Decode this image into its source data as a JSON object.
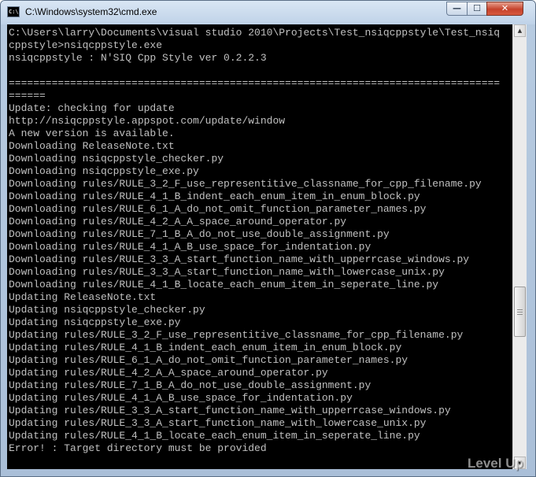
{
  "window": {
    "title": "C:\\Windows\\system32\\cmd.exe",
    "icon": "C:\\",
    "controls": {
      "minimize": "—",
      "maximize": "☐",
      "close": "✕"
    }
  },
  "console": {
    "lines": [
      "C:\\Users\\larry\\Documents\\visual studio 2010\\Projects\\Test_nsiqcppstyle\\Test_nsiq",
      "cppstyle>nsiqcppstyle.exe",
      "nsiqcppstyle : N'SIQ Cpp Style ver 0.2.2.3",
      "",
      "================================================================================",
      "======",
      "Update: checking for update",
      "http://nsiqcppstyle.appspot.com/update/window",
      "A new version is available.",
      "Downloading ReleaseNote.txt",
      "Downloading nsiqcppstyle_checker.py",
      "Downloading nsiqcppstyle_exe.py",
      "Downloading rules/RULE_3_2_F_use_representitive_classname_for_cpp_filename.py",
      "Downloading rules/RULE_4_1_B_indent_each_enum_item_in_enum_block.py",
      "Downloading rules/RULE_6_1_A_do_not_omit_function_parameter_names.py",
      "Downloading rules/RULE_4_2_A_A_space_around_operator.py",
      "Downloading rules/RULE_7_1_B_A_do_not_use_double_assignment.py",
      "Downloading rules/RULE_4_1_A_B_use_space_for_indentation.py",
      "Downloading rules/RULE_3_3_A_start_function_name_with_upperrcase_windows.py",
      "Downloading rules/RULE_3_3_A_start_function_name_with_lowercase_unix.py",
      "Downloading rules/RULE_4_1_B_locate_each_enum_item_in_seperate_line.py",
      "Updating ReleaseNote.txt",
      "Updating nsiqcppstyle_checker.py",
      "Updating nsiqcppstyle_exe.py",
      "Updating rules/RULE_3_2_F_use_representitive_classname_for_cpp_filename.py",
      "Updating rules/RULE_4_1_B_indent_each_enum_item_in_enum_block.py",
      "Updating rules/RULE_6_1_A_do_not_omit_function_parameter_names.py",
      "Updating rules/RULE_4_2_A_A_space_around_operator.py",
      "Updating rules/RULE_7_1_B_A_do_not_use_double_assignment.py",
      "Updating rules/RULE_4_1_A_B_use_space_for_indentation.py",
      "Updating rules/RULE_3_3_A_start_function_name_with_upperrcase_windows.py",
      "Updating rules/RULE_3_3_A_start_function_name_with_lowercase_unix.py",
      "Updating rules/RULE_4_1_B_locate_each_enum_item_in_seperate_line.py",
      "Error! : Target directory must be provided"
    ]
  },
  "scrollbar": {
    "up_arrow": "▲",
    "down_arrow": "▼"
  },
  "watermark": "Level Up",
  "colors": {
    "console_background": "#000000",
    "console_text": "#c0c0c0",
    "window_frame": "#b7cbe1",
    "close_button": "#c6432c"
  }
}
